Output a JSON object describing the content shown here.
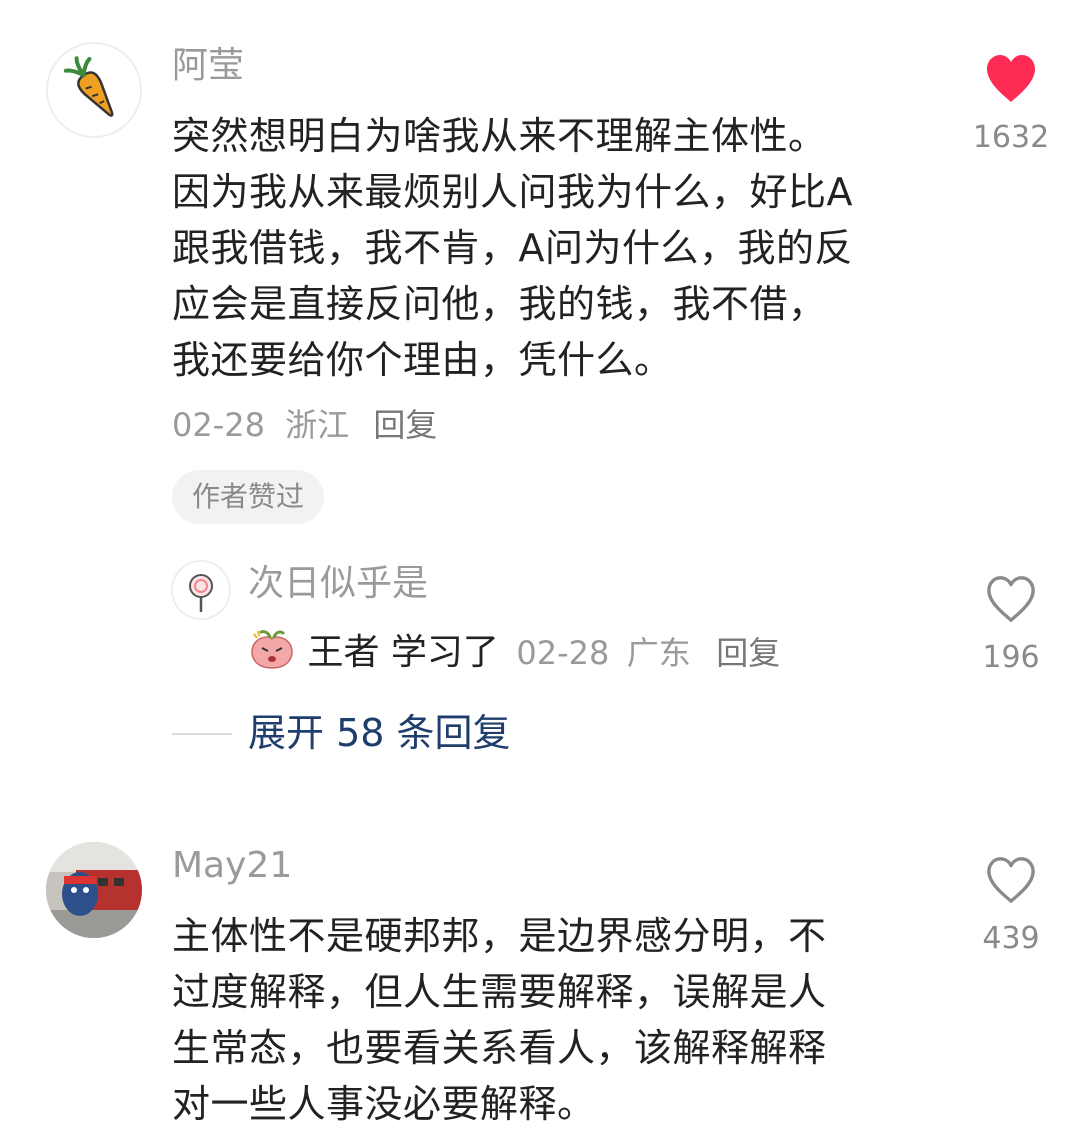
{
  "comments": [
    {
      "username": "阿莹",
      "avatar_icon": "carrot-icon",
      "text": "突然想明白为啥我从来不理解主体性。\n因为我从来最烦别人问我为什么，好比A\n跟我借钱，我不肯，A问为什么，我的反\n应会是直接反问他，我的钱，我不借，\n我还要给你个理由，凭什么。",
      "date": "02-28",
      "location": "浙江",
      "reply_label": "回复",
      "badge": "作者赞过",
      "likes": "1632",
      "liked": true,
      "like_color": "#fe2c55",
      "replies": [
        {
          "username": "次日似乎是",
          "avatar_icon": "lollipop-icon",
          "emoji": "angry-peach-emoji",
          "text": "王者 学习了",
          "date": "02-28",
          "location": "广东",
          "reply_label": "回复",
          "likes": "196"
        }
      ],
      "expand_label": "展开 58 条回复"
    },
    {
      "username": "May21",
      "avatar_icon": "photo-avatar",
      "text": "主体性不是硬邦邦，是边界感分明，不\n过度解释，但人生需要解释，误解是人\n生常态，也要看关系看人，该解释解释\n对一些人事没必要解释。",
      "likes": "439"
    }
  ],
  "colors": {
    "accent_link": "#1f3e6c",
    "muted_text": "#9a9a9a",
    "body_text": "#222222"
  }
}
